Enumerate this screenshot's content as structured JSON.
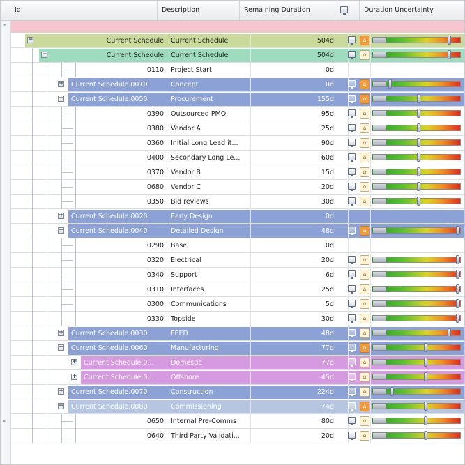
{
  "grid": {
    "columns": [
      "Id",
      "Description",
      "Remaining Duration",
      "",
      "Duration Uncertainty"
    ],
    "header_icons": {
      "col3": "monitor-icon"
    },
    "filter_row": {
      "color": "#f6c6cf"
    },
    "colors": {
      "summary_blue": "#8ca1d5",
      "root_green_yellow": "#c9da9b",
      "root_green": "#9fdcbd",
      "pink_group": "#d69ae0",
      "light_blue": "#b6c6e1",
      "white_text": "#ffffff"
    },
    "rows": [
      {
        "id": "Current Schedule",
        "desc": "Current Schedule",
        "dur": "504d",
        "depth": 0,
        "expander": "−",
        "band": "root",
        "monitor": true,
        "dist": true,
        "dist_hl": true,
        "uncertainty": 0.87
      },
      {
        "id": "Current Schedule",
        "desc": "Current Schedule",
        "dur": "504d",
        "depth": 1,
        "expander": "−",
        "band": "root2",
        "monitor": true,
        "dist": true,
        "dist_hl": false,
        "uncertainty": 0.87
      },
      {
        "id": "0110",
        "desc": "Project Start",
        "dur": "0d",
        "depth": 3,
        "expander": "",
        "band": "leaf",
        "monitor": false,
        "dist": false,
        "uncertainty": null
      },
      {
        "id": "Current Schedule.0010",
        "desc": "Concept",
        "dur": "0d",
        "depth": 2,
        "expander": "+",
        "band": "summary",
        "monitor": true,
        "dist": true,
        "dist_hl": true,
        "uncertainty": 0.2
      },
      {
        "id": "Current Schedule.0050",
        "desc": "Procurement",
        "dur": "155d",
        "depth": 2,
        "expander": "−",
        "band": "summary",
        "monitor": true,
        "dist": true,
        "dist_hl": true,
        "uncertainty": 0.52
      },
      {
        "id": "0390",
        "desc": "Outsourced PMO",
        "dur": "95d",
        "depth": 3,
        "expander": "",
        "band": "leaf",
        "monitor": true,
        "dist": true,
        "dist_hl": false,
        "uncertainty": 0.52
      },
      {
        "id": "0380",
        "desc": "Vendor A",
        "dur": "25d",
        "depth": 3,
        "expander": "",
        "band": "leaf",
        "monitor": true,
        "dist": true,
        "dist_hl": false,
        "uncertainty": 0.52
      },
      {
        "id": "0360",
        "desc": "Initial Long Lead it...",
        "dur": "90d",
        "depth": 3,
        "expander": "",
        "band": "leaf",
        "monitor": true,
        "dist": true,
        "dist_hl": false,
        "uncertainty": 0.52
      },
      {
        "id": "0400",
        "desc": "Secondary Long Le...",
        "dur": "60d",
        "depth": 3,
        "expander": "",
        "band": "leaf",
        "monitor": true,
        "dist": true,
        "dist_hl": false,
        "uncertainty": 0.52
      },
      {
        "id": "0370",
        "desc": "Vendor B",
        "dur": "15d",
        "depth": 3,
        "expander": "",
        "band": "leaf",
        "monitor": true,
        "dist": true,
        "dist_hl": false,
        "uncertainty": 0.52
      },
      {
        "id": "0680",
        "desc": "Vendor C",
        "dur": "20d",
        "depth": 3,
        "expander": "",
        "band": "leaf",
        "monitor": true,
        "dist": true,
        "dist_hl": false,
        "uncertainty": 0.52
      },
      {
        "id": "0350",
        "desc": "Bid reviews",
        "dur": "30d",
        "depth": 3,
        "expander": "",
        "band": "leaf",
        "monitor": true,
        "dist": true,
        "dist_hl": false,
        "uncertainty": 0.52
      },
      {
        "id": "Current Schedule.0020",
        "desc": "Early Design",
        "dur": "0d",
        "depth": 2,
        "expander": "+",
        "band": "summary",
        "monitor": false,
        "dist": false,
        "uncertainty": null
      },
      {
        "id": "Current Schedule.0040",
        "desc": "Detailed Design",
        "dur": "48d",
        "depth": 2,
        "expander": "−",
        "band": "summary",
        "monitor": true,
        "dist": true,
        "dist_hl": true,
        "uncertainty": 0.97
      },
      {
        "id": "0290",
        "desc": "Base",
        "dur": "0d",
        "depth": 3,
        "expander": "",
        "band": "leaf",
        "monitor": false,
        "dist": false,
        "uncertainty": null
      },
      {
        "id": "0320",
        "desc": "Electrical",
        "dur": "20d",
        "depth": 3,
        "expander": "",
        "band": "leaf",
        "monitor": true,
        "dist": true,
        "dist_hl": false,
        "uncertainty": 0.97
      },
      {
        "id": "0340",
        "desc": "Support",
        "dur": "6d",
        "depth": 3,
        "expander": "",
        "band": "leaf",
        "monitor": true,
        "dist": true,
        "dist_hl": false,
        "uncertainty": 0.97
      },
      {
        "id": "0310",
        "desc": "Interfaces",
        "dur": "25d",
        "depth": 3,
        "expander": "",
        "band": "leaf",
        "monitor": true,
        "dist": true,
        "dist_hl": false,
        "uncertainty": 0.97
      },
      {
        "id": "0300",
        "desc": "Communications",
        "dur": "5d",
        "depth": 3,
        "expander": "",
        "band": "leaf",
        "monitor": true,
        "dist": true,
        "dist_hl": false,
        "uncertainty": 0.97
      },
      {
        "id": "0330",
        "desc": "Topside",
        "dur": "30d",
        "depth": 3,
        "expander": "",
        "band": "leaf",
        "monitor": true,
        "dist": true,
        "dist_hl": false,
        "uncertainty": 0.97
      },
      {
        "id": "Current Schedule.0030",
        "desc": "FEED",
        "dur": "48d",
        "depth": 2,
        "expander": "+",
        "band": "summary",
        "monitor": true,
        "dist": true,
        "dist_hl": false,
        "uncertainty": 0.87
      },
      {
        "id": "Current Schedule.0060",
        "desc": "Manufacturing",
        "dur": "77d",
        "depth": 2,
        "expander": "−",
        "band": "summary",
        "monitor": true,
        "dist": true,
        "dist_hl": true,
        "uncertainty": 0.6
      },
      {
        "id": "Current Schedule.0...",
        "desc": "Domestic",
        "dur": "77d",
        "depth": 2.5,
        "expander": "+",
        "band": "pink",
        "monitor": true,
        "dist": true,
        "dist_hl": false,
        "uncertainty": 0.6
      },
      {
        "id": "Current Schedule.0...",
        "desc": "Offshore",
        "dur": "45d",
        "depth": 2.5,
        "expander": "+",
        "band": "pink",
        "monitor": true,
        "dist": true,
        "dist_hl": false,
        "uncertainty": 0.6
      },
      {
        "id": "Current Schedule.0070",
        "desc": "Construction",
        "dur": "224d",
        "depth": 2,
        "expander": "+",
        "band": "summary",
        "monitor": true,
        "dist": true,
        "dist_hl": false,
        "uncertainty": 0.22
      },
      {
        "id": "Current Schedule.0080",
        "desc": "Commissioning",
        "dur": "74d",
        "depth": 2,
        "expander": "−",
        "band": "lightblue",
        "monitor": true,
        "dist": true,
        "dist_hl": true,
        "uncertainty": 0.6
      },
      {
        "id": "0650",
        "desc": "Internal Pre-Comms",
        "dur": "80d",
        "depth": 3,
        "expander": "",
        "band": "leaf",
        "monitor": true,
        "dist": true,
        "dist_hl": false,
        "uncertainty": 0.6
      },
      {
        "id": "0640",
        "desc": "Third Party Validati...",
        "dur": "20d",
        "depth": 3,
        "expander": "",
        "band": "leaf",
        "monitor": true,
        "dist": true,
        "dist_hl": false,
        "uncertainty": 0.6
      }
    ]
  }
}
